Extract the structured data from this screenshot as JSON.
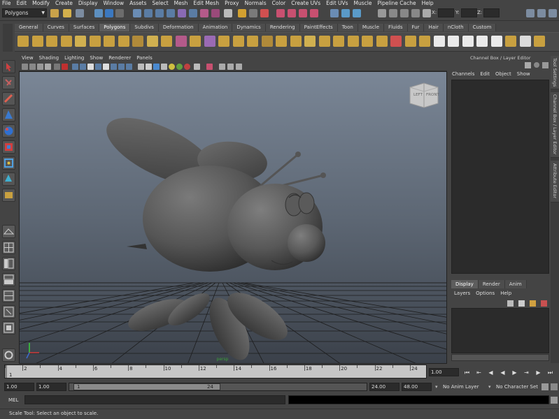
{
  "menubar": [
    "File",
    "Edit",
    "Modify",
    "Create",
    "Display",
    "Window",
    "Assets",
    "Select",
    "Mesh",
    "Edit Mesh",
    "Proxy",
    "Normals",
    "Color",
    "Create UVs",
    "Edit UVs",
    "Muscle",
    "Pipeline Cache",
    "Help"
  ],
  "status": {
    "mode": "Polygons",
    "coord_x_label": "X:",
    "coord_y_label": "Y:",
    "coord_z_label": "Z:"
  },
  "shelf_tabs": [
    "General",
    "Curves",
    "Surfaces",
    "Polygons",
    "Subdivs",
    "Deformation",
    "Animation",
    "Dynamics",
    "Rendering",
    "PaintEffects",
    "Toon",
    "Muscle",
    "Fluids",
    "Fur",
    "Hair",
    "nCloth",
    "Custom"
  ],
  "shelf_active": "Polygons",
  "panel_menu": [
    "View",
    "Shading",
    "Lighting",
    "Show",
    "Renderer",
    "Panels"
  ],
  "viewcube": {
    "left": "LEFT",
    "front": "FRONT"
  },
  "camera_label": "persp",
  "channel_box": {
    "header": "Channel Box / Layer Editor",
    "menu": [
      "Channels",
      "Edit",
      "Object",
      "Show"
    ]
  },
  "layer_editor": {
    "tabs": [
      "Display",
      "Render",
      "Anim"
    ],
    "active_tab": "Display",
    "menu": [
      "Layers",
      "Options",
      "Help"
    ]
  },
  "side_tabs": [
    "Tool Settings",
    "Channel Box / Layer Editor",
    "Attribute Editor"
  ],
  "timeline": {
    "ticks": [
      "2",
      "4",
      "6",
      "8",
      "10",
      "12",
      "14",
      "16",
      "18",
      "20",
      "22",
      "24"
    ],
    "start_label": "1",
    "current_frame": "1.00"
  },
  "range": {
    "start": "1.00",
    "playback_start": "1.00",
    "slider_start": "1",
    "slider_end": "24",
    "playback_end": "24.00",
    "end": "48.00",
    "anim_layer": "No Anim Layer",
    "character_set": "No Character Set"
  },
  "command": {
    "label": "MEL"
  },
  "help_line": "Scale Tool: Select an object to scale."
}
